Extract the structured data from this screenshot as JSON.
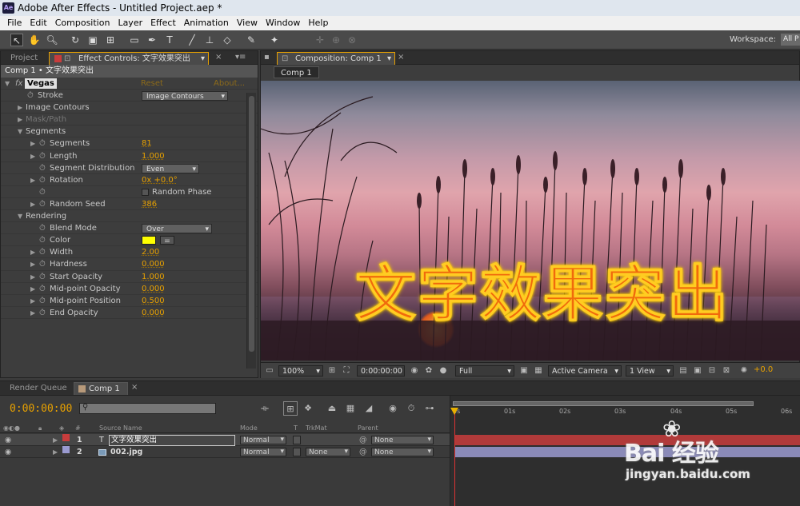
{
  "app": {
    "title": "Adobe After Effects - Untitled Project.aep *",
    "icon": "Ae"
  },
  "menu": [
    "File",
    "Edit",
    "Composition",
    "Layer",
    "Effect",
    "Animation",
    "View",
    "Window",
    "Help"
  ],
  "toolbar": {
    "workspace_label": "Workspace:",
    "workspace_value": "All P"
  },
  "left_panel": {
    "tabs": {
      "project": "Project",
      "effect_controls": "Effect Controls: 文字效果突出"
    },
    "header": "Comp 1 • 文字效果突出",
    "effect": {
      "name": "Vegas",
      "reset": "Reset",
      "about": "About..."
    },
    "rows": {
      "stroke": {
        "label": "Stroke",
        "value": "Image Contours"
      },
      "image_contours": "Image Contours",
      "mask_path": "Mask/Path",
      "segments_group": "Segments",
      "segments": {
        "label": "Segments",
        "value": "81"
      },
      "length": {
        "label": "Length",
        "value": "1.000"
      },
      "seg_dist": {
        "label": "Segment Distribution",
        "value": "Even"
      },
      "rotation": {
        "label": "Rotation",
        "value": "0x +0.0°"
      },
      "random_phase": "Random Phase",
      "random_seed": {
        "label": "Random Seed",
        "value": "386"
      },
      "rendering_group": "Rendering",
      "blend_mode": {
        "label": "Blend Mode",
        "value": "Over"
      },
      "color": {
        "label": "Color",
        "hex": "#ffff00"
      },
      "width": {
        "label": "Width",
        "value": "2.00"
      },
      "hardness": {
        "label": "Hardness",
        "value": "0.000"
      },
      "start_opacity": {
        "label": "Start Opacity",
        "value": "1.000"
      },
      "mid_opacity": {
        "label": "Mid-point Opacity",
        "value": "0.000"
      },
      "mid_position": {
        "label": "Mid-point Position",
        "value": "0.500"
      },
      "end_opacity": {
        "label": "End Opacity",
        "value": "0.000"
      }
    }
  },
  "comp_panel": {
    "tab": "Composition: Comp 1",
    "subtab": "Comp 1",
    "overlay_text": "文字效果突出",
    "viewer_bar": {
      "zoom": "100%",
      "timecode": "0:00:00:00",
      "resolution": "Full",
      "camera": "Active Camera",
      "views": "1 View",
      "exposure": "+0.0"
    }
  },
  "timeline": {
    "tabs": {
      "render_queue": "Render Queue",
      "comp": "Comp 1"
    },
    "timecode": "0:00:00:00",
    "columns": {
      "num": "#",
      "source": "Source Name",
      "mode": "Mode",
      "t": "T",
      "trkmat": "TrkMat",
      "parent": "Parent"
    },
    "layers": [
      {
        "num": "1",
        "type": "T",
        "name": "文字效果突出",
        "mode": "Normal",
        "trkmat": "",
        "parent": "None",
        "color": "#c83c3c"
      },
      {
        "num": "2",
        "type": "img",
        "name": "002.jpg",
        "mode": "Normal",
        "trkmat": "None",
        "parent": "None",
        "color": "#9a9ad0"
      }
    ],
    "ruler": [
      "0s",
      "01s",
      "02s",
      "03s",
      "04s",
      "05s",
      "06s"
    ]
  },
  "watermark": {
    "logo": "Bai  经验",
    "url": "jingyan.baidu.com"
  }
}
